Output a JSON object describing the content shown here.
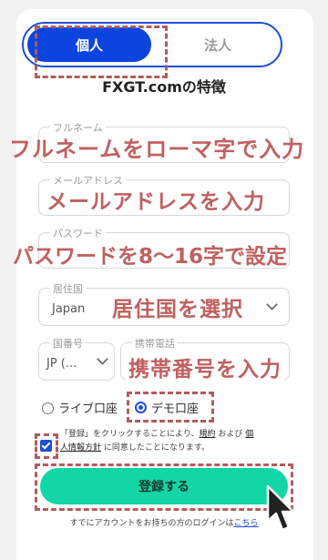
{
  "tabs": {
    "personal": "個人",
    "corporate": "法人"
  },
  "features_title": "FXGT.comの特徴",
  "form": {
    "fullname_label": "フルネーム",
    "email_label": "メールアドレス",
    "password_label": "パスワード",
    "residence_label": "居住国",
    "residence_value": "Japan",
    "country_code_label": "国番号",
    "country_code_value": "JP (...",
    "phone_label": "携帯電話"
  },
  "annotations": {
    "fullname": "フルネームをローマ字で入力",
    "email": "メールアドレスを入力",
    "password": "パスワードを8〜16字で設定",
    "residence": "居住国を選択",
    "phone": "携帯番号を入力"
  },
  "account_type": {
    "live": "ライブ口座",
    "demo": "デモ口座",
    "selected": "demo"
  },
  "agreement": {
    "text_before": "「登録」をクリックすることにより、",
    "terms_link": "規約",
    "middle": " および ",
    "privacy_link_1": "個",
    "privacy_link_2": "人情報方針",
    "text_after": " に同意したことになります。",
    "checked": true
  },
  "register_button": "登録する",
  "login_prompt": {
    "text": "すでにアカウントをお持ちの方のログインは",
    "link": "こちら"
  },
  "colors": {
    "primary_blue": "#0c44e0",
    "accent_green": "#12d6a5",
    "annotation_red": "#c0605f"
  }
}
